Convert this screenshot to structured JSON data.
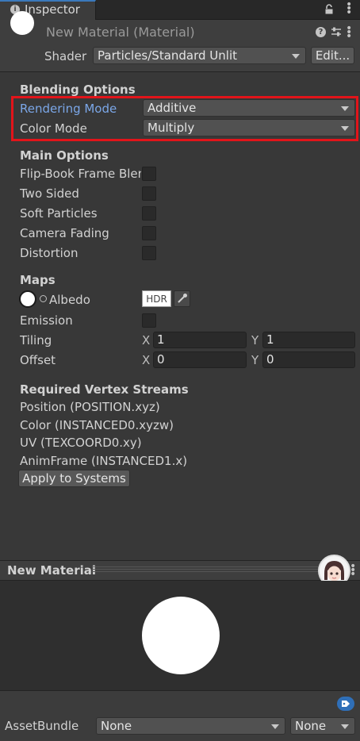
{
  "tab": {
    "label": "Inspector"
  },
  "header": {
    "title": "New Material (Material)",
    "shader_label": "Shader",
    "shader_value": "Particles/Standard Unlit",
    "edit_label": "Edit..."
  },
  "blending": {
    "title": "Blending Options",
    "rendering_mode_label": "Rendering Mode",
    "rendering_mode_value": "Additive",
    "color_mode_label": "Color Mode",
    "color_mode_value": "Multiply"
  },
  "main_options": {
    "title": "Main Options",
    "items": [
      {
        "label": "Flip-Book Frame Blending",
        "checked": false
      },
      {
        "label": "Two Sided",
        "checked": false
      },
      {
        "label": "Soft Particles",
        "checked": false
      },
      {
        "label": "Camera Fading",
        "checked": false
      },
      {
        "label": "Distortion",
        "checked": false
      }
    ]
  },
  "maps": {
    "title": "Maps",
    "albedo_label": "Albedo",
    "hdr_label": "HDR",
    "emission_label": "Emission",
    "tiling_label": "Tiling",
    "offset_label": "Offset",
    "x_letter": "X",
    "y_letter": "Y",
    "tiling_x": "1",
    "tiling_y": "1",
    "offset_x": "0",
    "offset_y": "0"
  },
  "vertex_streams": {
    "title": "Required Vertex Streams",
    "items": [
      "Position (POSITION.xyz)",
      "Color (INSTANCED0.xyzw)",
      "UV (TEXCOORD0.xy)",
      "AnimFrame (INSTANCED1.x)"
    ],
    "apply_label": "Apply to Systems"
  },
  "preview": {
    "title": "New Material"
  },
  "asset_bundle": {
    "label": "AssetBundle",
    "name_value": "None",
    "variant_value": "None"
  },
  "colors": {
    "highlight": "#e2141a",
    "label_active": "#7ba7e8",
    "tag_blue": "#2f6fb8"
  }
}
